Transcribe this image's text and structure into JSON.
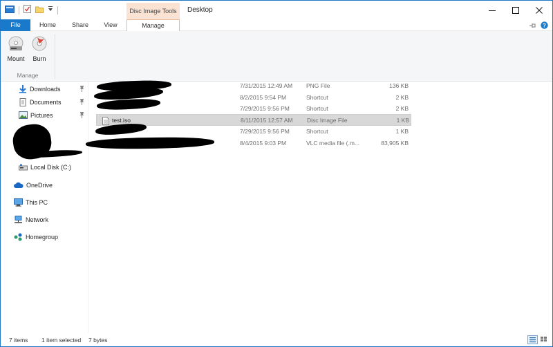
{
  "titlebar": {
    "context_tab_title": "Disc Image Tools",
    "window_title": "Desktop",
    "minimize_glyph": "—",
    "maximize_glyph": "☐",
    "close_glyph": "✕"
  },
  "ribbon_tabs": {
    "file": "File",
    "home": "Home",
    "share": "Share",
    "view": "View",
    "manage": "Manage"
  },
  "ribbon": {
    "mount_label": "Mount",
    "burn_label": "Burn",
    "group_label": "Manage"
  },
  "nav": {
    "items": [
      {
        "label": "Downloads",
        "icon": "download-arrow-icon",
        "pinned": true
      },
      {
        "label": "Documents",
        "icon": "documents-icon",
        "pinned": true
      },
      {
        "label": "Pictures",
        "icon": "pictures-icon",
        "pinned": true
      },
      {
        "label": "Local Disk (C:)",
        "icon": "drive-icon"
      },
      {
        "label": "OneDrive",
        "icon": "cloud-icon"
      },
      {
        "label": "This PC",
        "icon": "computer-icon"
      },
      {
        "label": "Network",
        "icon": "network-icon"
      },
      {
        "label": "Homegroup",
        "icon": "homegroup-icon"
      }
    ]
  },
  "files": [
    {
      "name": "",
      "date": "7/31/2015 12:49 AM",
      "type": "PNG File",
      "size": "136 KB"
    },
    {
      "name": "",
      "date": "8/2/2015 9:54 PM",
      "type": "Shortcut",
      "size": "2 KB"
    },
    {
      "name": "",
      "date": "7/29/2015 9:56 PM",
      "type": "Shortcut",
      "size": "2 KB"
    },
    {
      "name": "test.iso",
      "date": "8/11/2015 12:57 AM",
      "type": "Disc Image File",
      "size": "1 KB",
      "selected": true
    },
    {
      "name": "",
      "date": "7/29/2015 9:56 PM",
      "type": "Shortcut",
      "size": "1 KB"
    },
    {
      "name": "",
      "date": "8/4/2015 9:03 PM",
      "type": "VLC media file (.m...",
      "size": "83,905 KB"
    }
  ],
  "status": {
    "items_count": "7 items",
    "selected": "1 item selected",
    "size": "7 bytes"
  },
  "colors": {
    "accent": "#1979ca",
    "context_tab": "#fbe3d3",
    "selection": "#d8d8d8"
  }
}
